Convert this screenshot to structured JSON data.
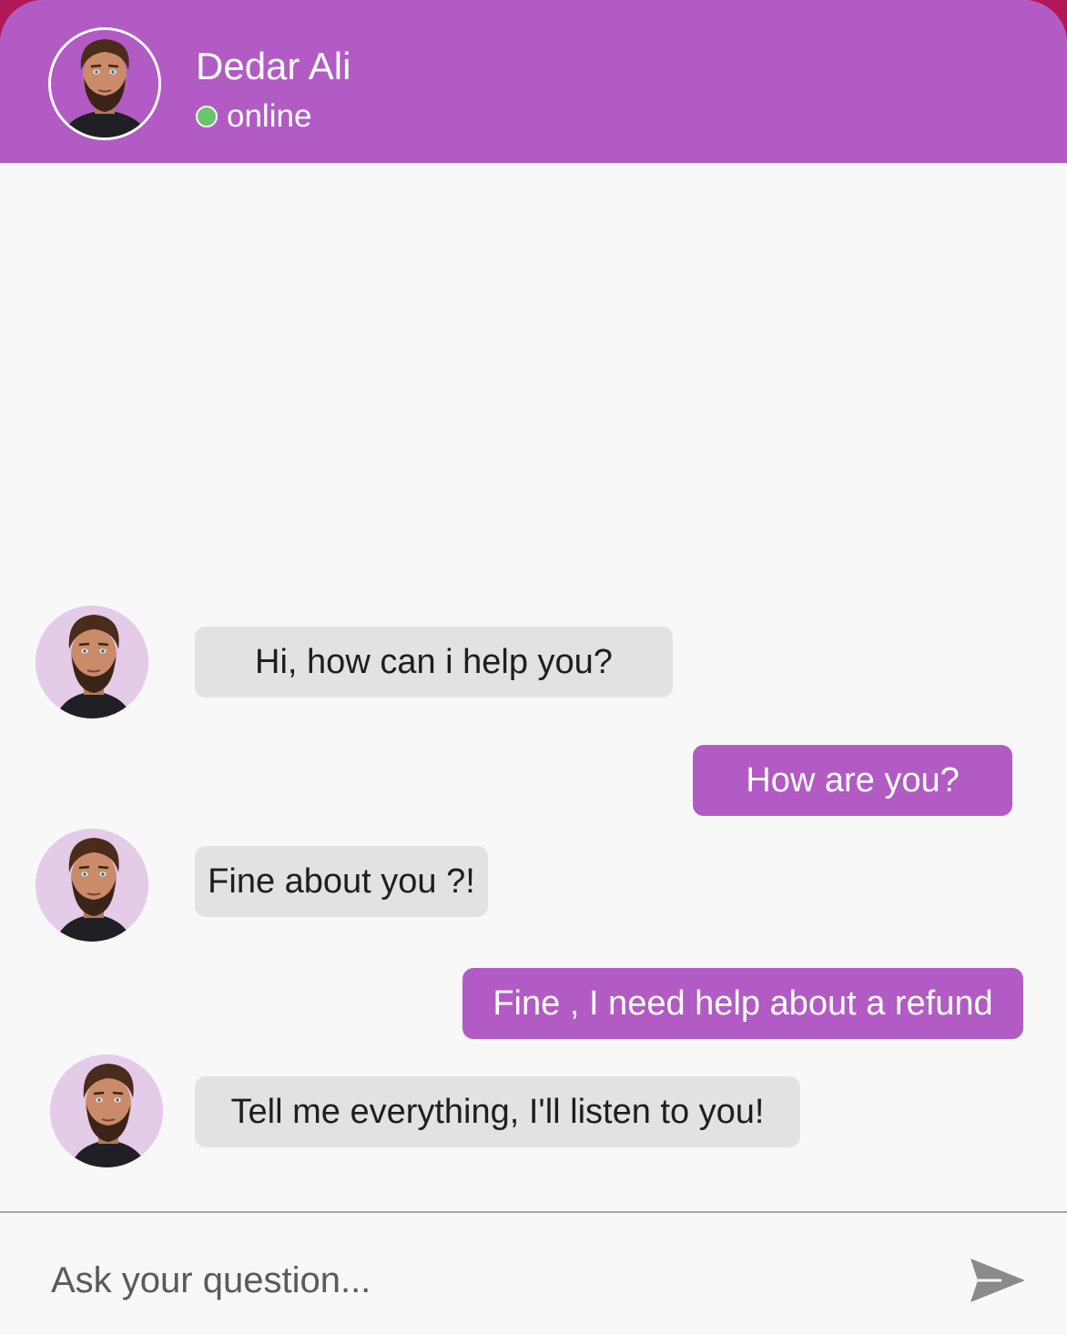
{
  "contact": {
    "name": "Dedar Ali",
    "status": "online",
    "status_color": "#6cc26f"
  },
  "theme": {
    "primary": "#b25bc4",
    "bot_bubble": "#e2e2e2",
    "avatar_bg": "#e4cbe8"
  },
  "messages": [
    {
      "sender": "bot",
      "text": "Hi, how can i help you?"
    },
    {
      "sender": "user",
      "text": "How are you?"
    },
    {
      "sender": "bot",
      "text": "Fine about you ?!"
    },
    {
      "sender": "user",
      "text": "Fine , I need help about a refund"
    },
    {
      "sender": "bot",
      "text": "Tell me everything, I'll listen to you!"
    }
  ],
  "composer": {
    "placeholder": "Ask your question...",
    "send_icon": "send-icon"
  }
}
